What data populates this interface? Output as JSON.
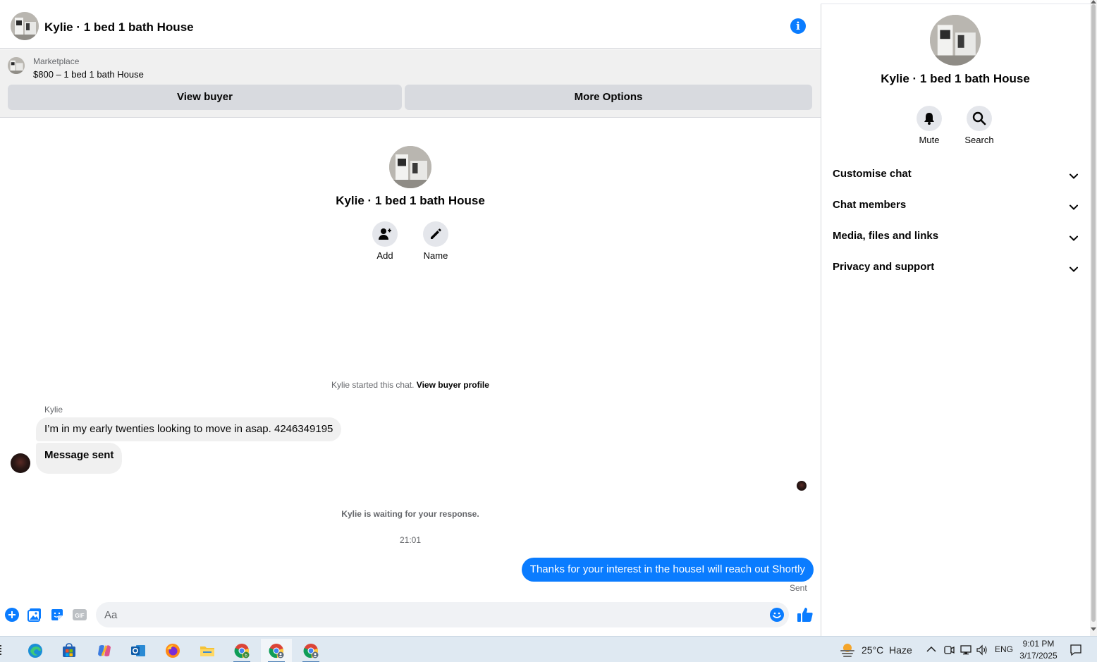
{
  "chat": {
    "header_title": "Kylie · 1 bed 1 bath House",
    "info_icon": "info-icon",
    "marketplace": {
      "label": "Marketplace",
      "listing": "$800 – 1 bed 1 bath House",
      "view_buyer": "View buyer",
      "more_options": "More Options"
    },
    "intro": {
      "title": "Kylie · 1 bed 1 bath House",
      "add_label": "Add",
      "name_label": "Name"
    },
    "started_text": "Kylie started this chat.",
    "view_buyer_profile": "View buyer profile",
    "sender_name": "Kylie",
    "messages_in": [
      "I’m in my early twenties looking to move in asap. 4246349195",
      "Message sent"
    ],
    "waiting_text": "Kylie is waiting for your response.",
    "timestamp": "21:01",
    "message_out": "Thanks for your interest in the houseI will reach out Shortly",
    "sent_status": "Sent",
    "composer": {
      "placeholder": "Aa",
      "icons": [
        "plus-icon",
        "photo-icon",
        "sticker-icon",
        "gif-icon",
        "emoji-icon",
        "like-icon"
      ],
      "gif_text": "GIF"
    }
  },
  "info_panel": {
    "title": "Kylie · 1 bed 1 bath House",
    "actions": [
      {
        "label": "Mute",
        "icon": "bell-icon"
      },
      {
        "label": "Search",
        "icon": "search-icon"
      }
    ],
    "sections": [
      "Customise chat",
      "Chat members",
      "Media, files and links",
      "Privacy and support"
    ]
  },
  "taskbar": {
    "apps": [
      "edge",
      "store",
      "copilot",
      "outlook",
      "firefox",
      "file-explorer",
      "chrome-profile-b",
      "chrome-profile-1",
      "chrome-profile-2"
    ],
    "weather": "25°C  Haze",
    "language": "ENG",
    "time": "9:01 PM",
    "date": "3/17/2025"
  },
  "colors": {
    "accent": "#0a7cff",
    "bubble_in": "#f0f0f0",
    "secondary_text": "#65676b",
    "taskbar": "#dfe9f2"
  }
}
